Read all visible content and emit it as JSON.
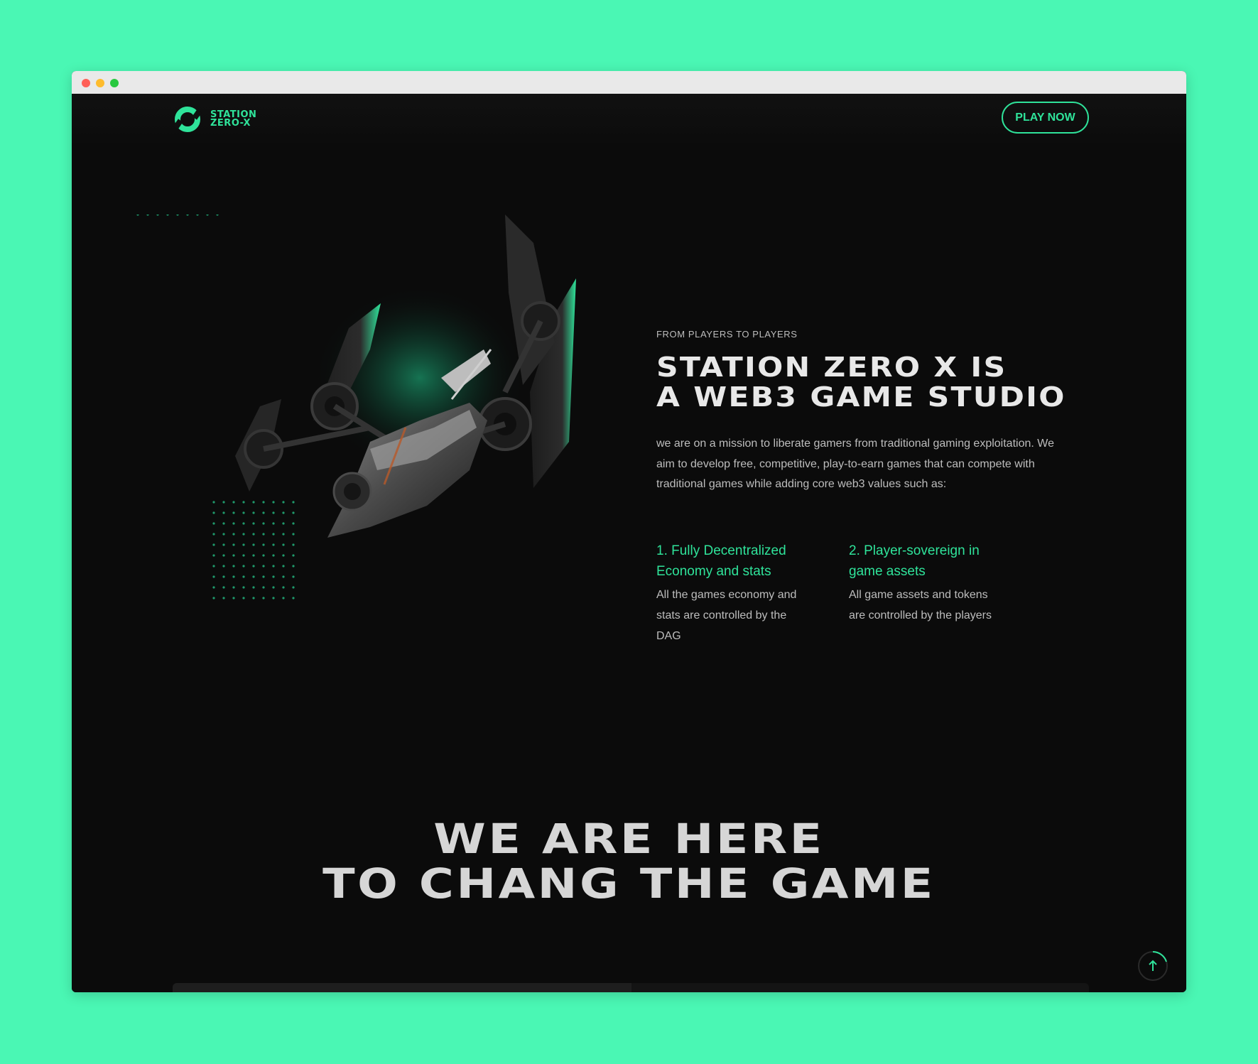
{
  "window": {
    "controls": [
      "close",
      "minimize",
      "maximize"
    ]
  },
  "brand": {
    "name_line1": "STATION",
    "name_line2": "ZERO-X",
    "accent": "#2fe39a",
    "background": "#4af7b4",
    "page_bg": "#0b0b0b"
  },
  "nav": {
    "cta_label": "PLAY NOW"
  },
  "about": {
    "eyebrow": "FROM PLAYERS TO PLAYERS",
    "headline_line1": "STATION ZERO X IS",
    "headline_line2": "A WEB3 GAME STUDIO",
    "intro": "we are on a mission to liberate gamers from traditional gaming exploitation. We aim to develop free, competitive, play-to-earn games that can compete with traditional games while adding core web3 values such as:",
    "features": [
      {
        "title": "1. Fully Decentralized Economy and stats",
        "text": "All the games economy and stats are controlled by the DAG"
      },
      {
        "title": "2. Player-sovereign in game assets",
        "text": "All game assets and tokens are controlled by the players"
      }
    ]
  },
  "tagline": {
    "line1": "WE ARE HERE",
    "line2": "TO CHANG THE GAME"
  },
  "icons": {
    "logo": "station-logo-icon",
    "scroll_top": "arrow-up-icon"
  }
}
